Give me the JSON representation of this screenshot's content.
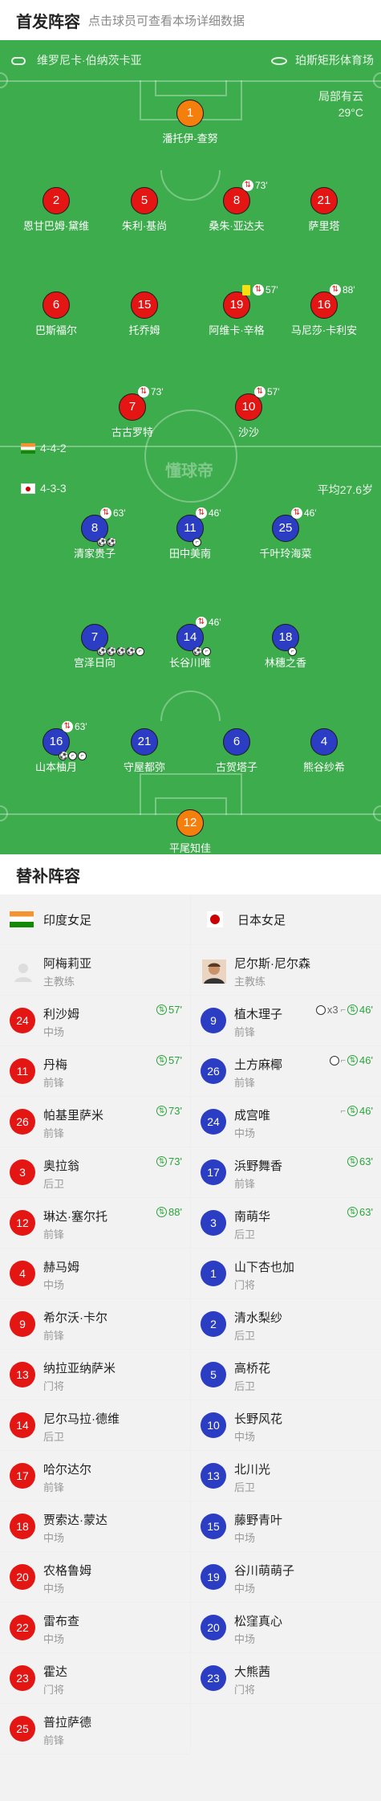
{
  "header": {
    "title": "首发阵容",
    "subtitle": "点击球员可查看本场详细数据"
  },
  "pitch": {
    "referee": "维罗尼卡·伯纳茨卡亚",
    "stadium": "珀斯矩形体育场",
    "weather": "局部有云",
    "temperature": "29°C",
    "watermark": "懂球帝",
    "home_formation": "4-4-2",
    "away_formation": "4-3-3",
    "away_avg_age": "平均27.6岁"
  },
  "home_players": [
    {
      "num": "1",
      "name": "潘托伊-查努",
      "color": "orange",
      "sub": "",
      "yellow": false,
      "goals": 0,
      "assists": 0
    },
    {
      "num": "2",
      "name": "恩甘巴姆·黛维",
      "color": "red",
      "sub": "",
      "yellow": false,
      "goals": 0,
      "assists": 0
    },
    {
      "num": "5",
      "name": "朱利·基尚",
      "color": "red",
      "sub": "",
      "yellow": false,
      "goals": 0,
      "assists": 0
    },
    {
      "num": "8",
      "name": "桑朱·亚达夫",
      "color": "red",
      "sub": "73'",
      "yellow": false,
      "goals": 0,
      "assists": 0
    },
    {
      "num": "21",
      "name": "萨里塔",
      "color": "red",
      "sub": "",
      "yellow": false,
      "goals": 0,
      "assists": 0
    },
    {
      "num": "6",
      "name": "巴斯福尔",
      "color": "red",
      "sub": "",
      "yellow": false,
      "goals": 0,
      "assists": 0
    },
    {
      "num": "15",
      "name": "托乔姆",
      "color": "red",
      "sub": "",
      "yellow": false,
      "goals": 0,
      "assists": 0
    },
    {
      "num": "19",
      "name": "阿维卡·辛格",
      "color": "red",
      "sub": "57'",
      "yellow": true,
      "goals": 0,
      "assists": 0
    },
    {
      "num": "16",
      "name": "马尼莎·卡利安",
      "color": "red",
      "sub": "88'",
      "yellow": false,
      "goals": 0,
      "assists": 0
    },
    {
      "num": "7",
      "name": "古古罗特",
      "color": "red",
      "sub": "73'",
      "yellow": false,
      "goals": 0,
      "assists": 0
    },
    {
      "num": "10",
      "name": "沙沙",
      "color": "red",
      "sub": "57'",
      "yellow": false,
      "goals": 0,
      "assists": 0
    }
  ],
  "away_players": [
    {
      "num": "8",
      "name": "清家贵子",
      "color": "blue",
      "sub": "63'",
      "goals": 2,
      "assists": 0
    },
    {
      "num": "11",
      "name": "田中美南",
      "color": "blue",
      "sub": "46'",
      "goals": 0,
      "assists": 1
    },
    {
      "num": "25",
      "name": "千叶玲海菜",
      "color": "blue",
      "sub": "46'",
      "goals": 0,
      "assists": 0
    },
    {
      "num": "7",
      "name": "宫泽日向",
      "color": "blue",
      "sub": "",
      "goals": 4,
      "assists": 1
    },
    {
      "num": "14",
      "name": "长谷川唯",
      "color": "blue",
      "sub": "46'",
      "goals": 1,
      "assists": 1
    },
    {
      "num": "18",
      "name": "林穗之香",
      "color": "blue",
      "sub": "",
      "goals": 0,
      "assists": 1
    },
    {
      "num": "16",
      "name": "山本柚月",
      "color": "blue",
      "sub": "63'",
      "goals": 1,
      "assists": 2
    },
    {
      "num": "21",
      "name": "守屋都弥",
      "color": "blue",
      "sub": "",
      "goals": 0,
      "assists": 0
    },
    {
      "num": "6",
      "name": "古贺塔子",
      "color": "blue",
      "sub": "",
      "goals": 0,
      "assists": 0
    },
    {
      "num": "4",
      "name": "熊谷纱希",
      "color": "blue",
      "sub": "",
      "goals": 0,
      "assists": 0
    },
    {
      "num": "12",
      "name": "平尾知佳",
      "color": "orange",
      "sub": "",
      "goals": 0,
      "assists": 0
    }
  ],
  "bench": {
    "title": "替补阵容",
    "home_team": "印度女足",
    "away_team": "日本女足",
    "home_coach": {
      "name": "阿梅莉亚",
      "role": "主教练"
    },
    "away_coach": {
      "name": "尼尔斯·尼尔森",
      "role": "主教练"
    },
    "home": [
      {
        "num": "24",
        "name": "利沙姆",
        "pos": "中场",
        "sub": "57'"
      },
      {
        "num": "11",
        "name": "丹梅",
        "pos": "前锋",
        "sub": "57'"
      },
      {
        "num": "26",
        "name": "帕基里萨米",
        "pos": "前锋",
        "sub": "73'"
      },
      {
        "num": "3",
        "name": "奥拉翁",
        "pos": "后卫",
        "sub": "73'"
      },
      {
        "num": "12",
        "name": "琳达·塞尔托",
        "pos": "前锋",
        "sub": "88'"
      },
      {
        "num": "4",
        "name": "赫马姆",
        "pos": "中场",
        "sub": ""
      },
      {
        "num": "9",
        "name": "希尔沃·卡尔",
        "pos": "前锋",
        "sub": ""
      },
      {
        "num": "13",
        "name": "纳拉亚纳萨米",
        "pos": "门将",
        "sub": ""
      },
      {
        "num": "14",
        "name": "尼尔马拉·德维",
        "pos": "后卫",
        "sub": ""
      },
      {
        "num": "17",
        "name": "哈尔达尔",
        "pos": "前锋",
        "sub": ""
      },
      {
        "num": "18",
        "name": "贾索达·蒙达",
        "pos": "中场",
        "sub": ""
      },
      {
        "num": "20",
        "name": "农格鲁姆",
        "pos": "中场",
        "sub": ""
      },
      {
        "num": "22",
        "name": "雷布查",
        "pos": "中场",
        "sub": ""
      },
      {
        "num": "23",
        "name": "霍达",
        "pos": "门将",
        "sub": ""
      },
      {
        "num": "25",
        "name": "普拉萨德",
        "pos": "前锋",
        "sub": ""
      }
    ],
    "away": [
      {
        "num": "9",
        "name": "植木理子",
        "pos": "前锋",
        "sub": "46'",
        "goals_text": "x3",
        "goals": 1,
        "assist": true
      },
      {
        "num": "26",
        "name": "土方麻椰",
        "pos": "前锋",
        "sub": "46'",
        "goals_text": "",
        "goals": 1,
        "assist": true
      },
      {
        "num": "24",
        "name": "成宫唯",
        "pos": "中场",
        "sub": "46'",
        "goals_text": "",
        "goals": 0,
        "assist": true
      },
      {
        "num": "17",
        "name": "浜野舞香",
        "pos": "前锋",
        "sub": "63'",
        "goals_text": "",
        "goals": 0,
        "assist": false
      },
      {
        "num": "3",
        "name": "南萌华",
        "pos": "后卫",
        "sub": "63'",
        "goals_text": "",
        "goals": 0,
        "assist": false
      },
      {
        "num": "1",
        "name": "山下杏也加",
        "pos": "门将",
        "sub": "",
        "goals_text": "",
        "goals": 0,
        "assist": false
      },
      {
        "num": "2",
        "name": "清水梨纱",
        "pos": "后卫",
        "sub": "",
        "goals_text": "",
        "goals": 0,
        "assist": false
      },
      {
        "num": "5",
        "name": "高桥花",
        "pos": "后卫",
        "sub": "",
        "goals_text": "",
        "goals": 0,
        "assist": false
      },
      {
        "num": "10",
        "name": "长野风花",
        "pos": "中场",
        "sub": "",
        "goals_text": "",
        "goals": 0,
        "assist": false
      },
      {
        "num": "13",
        "name": "北川光",
        "pos": "后卫",
        "sub": "",
        "goals_text": "",
        "goals": 0,
        "assist": false
      },
      {
        "num": "15",
        "name": "藤野青叶",
        "pos": "中场",
        "sub": "",
        "goals_text": "",
        "goals": 0,
        "assist": false
      },
      {
        "num": "19",
        "name": "谷川萌萌子",
        "pos": "中场",
        "sub": "",
        "goals_text": "",
        "goals": 0,
        "assist": false
      },
      {
        "num": "20",
        "name": "松窪真心",
        "pos": "中场",
        "sub": "",
        "goals_text": "",
        "goals": 0,
        "assist": false
      },
      {
        "num": "23",
        "name": "大熊茜",
        "pos": "门将",
        "sub": "",
        "goals_text": "",
        "goals": 0,
        "assist": false
      }
    ]
  },
  "colors": {
    "pitch": "#3cac4c",
    "home": "#e41614",
    "away": "#2b3ec3",
    "goalkeeper": "#f57f0c",
    "sub_in": "#2aa43a"
  }
}
